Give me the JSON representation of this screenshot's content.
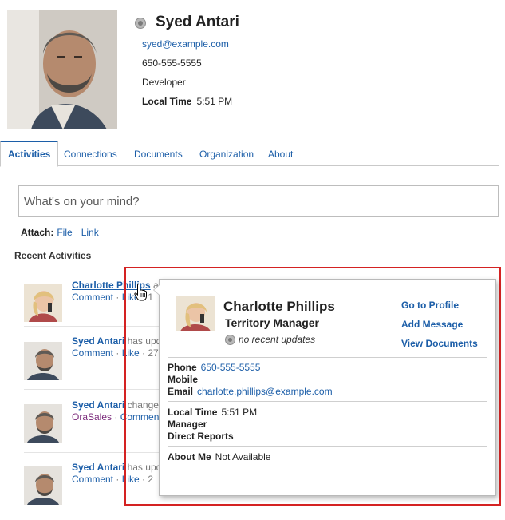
{
  "profile": {
    "name": "Syed Antari",
    "email": "syed@example.com",
    "phone": "650-555-5555",
    "title": "Developer",
    "local_time_label": "Local Time",
    "local_time_value": "5:51 PM",
    "presence_icon": "presence-offline-icon"
  },
  "tabs": [
    {
      "label": "Activities",
      "active": true
    },
    {
      "label": "Connections",
      "active": false
    },
    {
      "label": "Documents",
      "active": false
    },
    {
      "label": "Organization",
      "active": false
    },
    {
      "label": "About",
      "active": false
    }
  ],
  "status": {
    "placeholder": "What's on your mind?"
  },
  "attach": {
    "label": "Attach:",
    "file": "File",
    "link": "Link"
  },
  "recent_activities_title": "Recent Activities",
  "activities": [
    {
      "who": "Charlotte Phillips",
      "rest": " a",
      "actions": [
        "Comment",
        "Like",
        "1"
      ]
    },
    {
      "who": "Syed Antari",
      "rest": " has upd",
      "actions": [
        "Comment",
        "Like",
        "27"
      ]
    },
    {
      "who": "Syed Antari",
      "rest": " change",
      "actions": [
        "OraSales",
        "Comment"
      ]
    },
    {
      "who": "Syed Antari",
      "rest": " has upd",
      "actions": [
        "Comment",
        "Like",
        "2"
      ]
    }
  ],
  "popup": {
    "name": "Charlotte Phillips",
    "title": "Territory Manager",
    "status": "no recent updates",
    "links": {
      "go_to_profile": "Go to Profile",
      "add_message": "Add Message",
      "view_documents": "View Documents"
    },
    "phone_label": "Phone",
    "phone_value": "650-555-5555",
    "mobile_label": "Mobile",
    "email_label": "Email",
    "email_value": "charlotte.phillips@example.com",
    "local_time_label": "Local Time",
    "local_time_value": "5:51 PM",
    "manager_label": "Manager",
    "direct_reports_label": "Direct Reports",
    "about_me_label": "About Me",
    "about_me_value": "Not Available"
  },
  "colors": {
    "link": "#1c5ea8",
    "highlight": "#d42222",
    "purple_link": "#7b2b7b"
  }
}
